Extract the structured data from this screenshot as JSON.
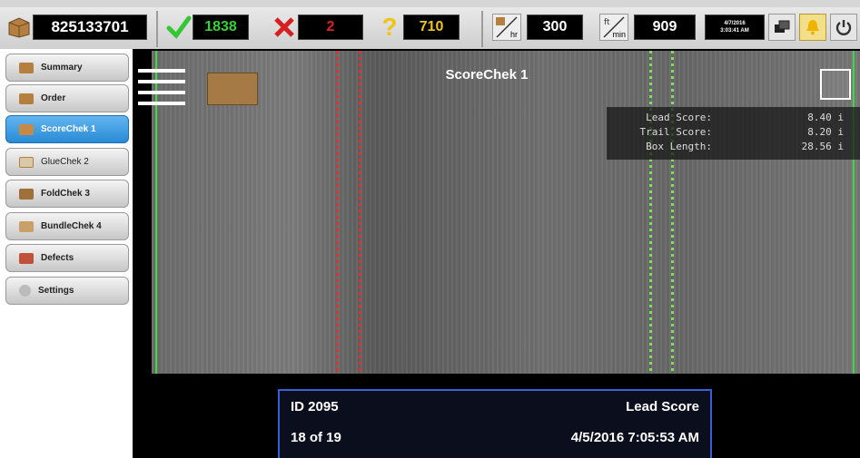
{
  "topbar": {
    "job_id": "825133701",
    "good_count": "1838",
    "reject_count": "2",
    "unknown_count": "710",
    "rate_per_hour": "300",
    "rate_per_min": "909",
    "rate_hour_unit": "hr",
    "rate_min_unit": "min",
    "datetime": "4/7/2016\n3:03:41 AM",
    "icons": [
      "box-icon",
      "check-icon",
      "x-icon",
      "question-icon",
      "box-per-hour-icon",
      "feet-per-min-icon",
      "date-time-icon",
      "window-switch-icon",
      "alert-icon",
      "power-icon"
    ]
  },
  "sidebar": {
    "items": [
      {
        "label": "Summary",
        "icon": "summary-icon",
        "active": false
      },
      {
        "label": "Order",
        "icon": "order-icon",
        "active": false
      },
      {
        "label": "ScoreChek 1",
        "icon": "scorechek-icon",
        "active": true
      },
      {
        "label": "GlueChek 2",
        "icon": "gluechek-icon",
        "active": false
      },
      {
        "label": "FoldChek 3",
        "icon": "foldchek-icon",
        "active": false
      },
      {
        "label": "BundleChek 4",
        "icon": "bundlechek-icon",
        "active": false
      },
      {
        "label": "Defects",
        "icon": "defects-icon",
        "active": false
      },
      {
        "label": "Settings",
        "icon": "settings-icon",
        "active": false
      }
    ]
  },
  "view": {
    "title": "ScoreChek 1",
    "scores": [
      {
        "label": "Lead Score:",
        "value": "8.40 i"
      },
      {
        "label": "Trail Score:",
        "value": "8.20 i"
      },
      {
        "label": "Box Length:",
        "value": "28.56 i"
      }
    ],
    "info": {
      "id": "ID 2095",
      "type": "Lead Score",
      "position": "18 of 19",
      "timestamp": "4/5/2016 7:05:53 AM"
    }
  },
  "colors": {
    "good": "#33d433",
    "reject": "#e02020",
    "unknown": "#f0c419",
    "active_tab": "#2a8ad6",
    "info_border": "#3a5fd6"
  }
}
